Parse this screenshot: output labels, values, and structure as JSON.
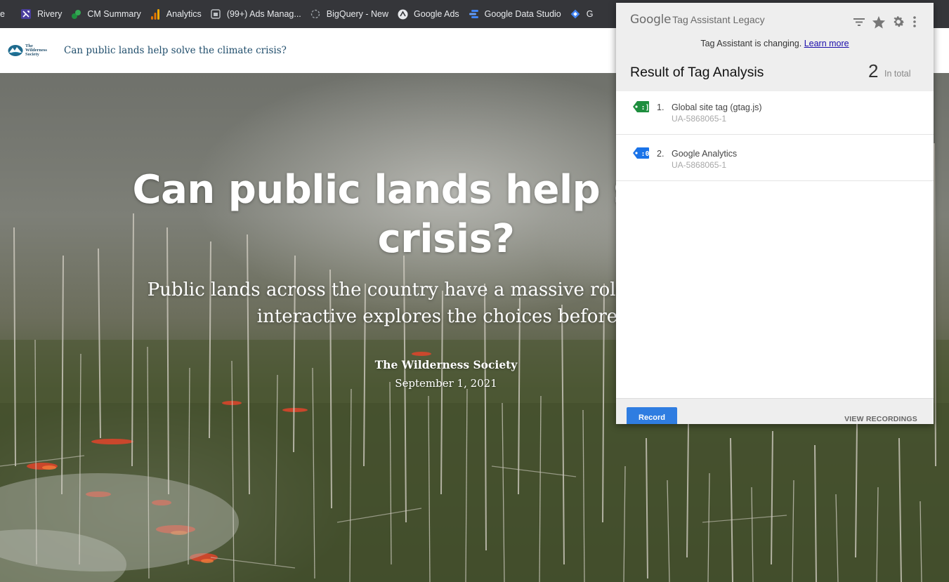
{
  "bookmarks": {
    "items": [
      {
        "label": "e",
        "icon": "bookmark-partial-icon"
      },
      {
        "label": "Rivery",
        "icon": "rivery-icon"
      },
      {
        "label": "CM Summary",
        "icon": "cm-summary-icon"
      },
      {
        "label": "Analytics",
        "icon": "analytics-icon"
      },
      {
        "label": "(99+) Ads Manag...",
        "icon": "ads-manager-icon"
      },
      {
        "label": "BigQuery - New",
        "icon": "bigquery-icon"
      },
      {
        "label": "Google Ads",
        "icon": "google-ads-icon"
      },
      {
        "label": "Google Data Studio",
        "icon": "data-studio-icon"
      },
      {
        "label": "G",
        "icon": "bookmark-diamond-icon"
      }
    ],
    "overflow": "..."
  },
  "site": {
    "logo_text": "The Wilderness Society",
    "header_title": "Can public lands help solve the climate crisis?",
    "hero": {
      "title_line1": "Can public lands help solve t",
      "title_line2": "crisis?",
      "sub_line1": "Public lands across the country have a massive role to play in so",
      "sub_line2": "interactive explores the choices before u",
      "author": "The Wilderness Society",
      "date": "September 1, 2021"
    }
  },
  "tag_assistant": {
    "brand_google": "Google",
    "brand_product": "Tag Assistant Legacy",
    "notice_text": "Tag Assistant is changing.",
    "notice_link": "Learn more",
    "result_title": "Result of Tag Analysis",
    "result_count": "2",
    "result_total_label": "In total",
    "tags": [
      {
        "number": "1.",
        "name": "Global site tag (gtag.js)",
        "id": "UA-5868065-1",
        "icon": "green-tag-icon",
        "color": "#1e8e3e"
      },
      {
        "number": "2.",
        "name": "Google Analytics",
        "id": "UA-5868065-1",
        "icon": "blue-tag-icon",
        "color": "#1a73e8"
      }
    ],
    "record_label": "Record",
    "view_recordings_label": "VIEW RECORDINGS",
    "icons": [
      "filter-icon",
      "star-icon",
      "gear-icon",
      "more-vert-icon"
    ]
  },
  "colors": {
    "chrome_bar": "#35363a",
    "site_title": "#1f4d6b",
    "record_button": "#2f7de1"
  }
}
